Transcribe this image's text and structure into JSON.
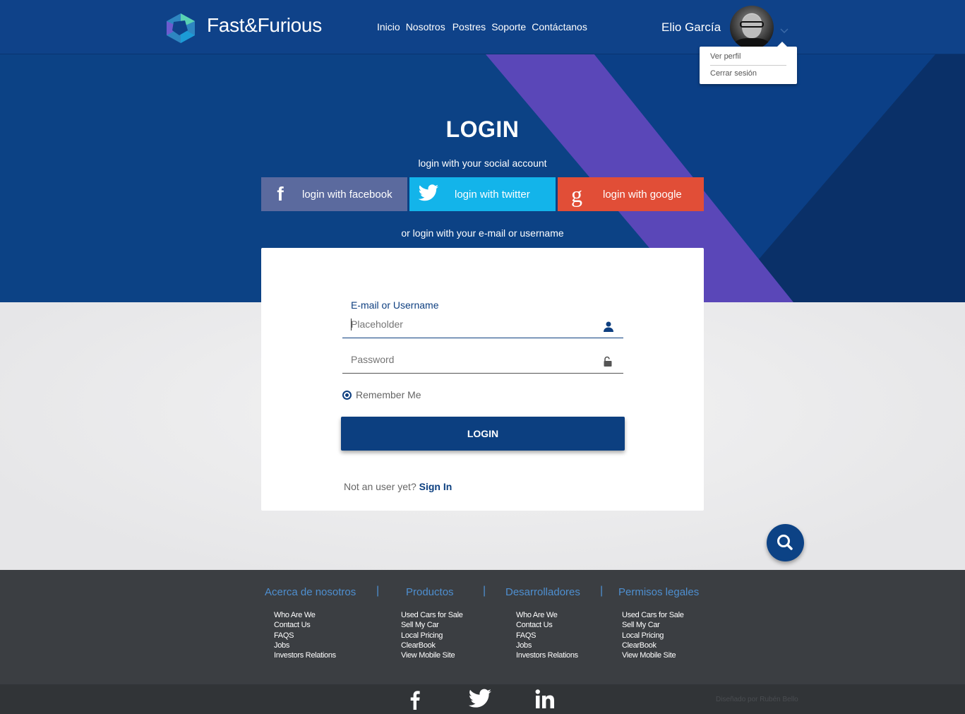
{
  "header": {
    "brand": "Fast&Furious",
    "nav": [
      "Inicio",
      "Nosotros",
      "Postres",
      "Soporte",
      "Contáctanos"
    ],
    "user_name": "Elio García",
    "dropdown": [
      "Ver perfil",
      "Cerrar sesión"
    ]
  },
  "login": {
    "title": "LOGIN",
    "social_caption": "login with your social account",
    "facebook_label": "login with facebook",
    "twitter_label": "login with twitter",
    "google_label": "login with google",
    "or_caption": "or login with your e-mail or username"
  },
  "form": {
    "user_label": "E-mail or Username",
    "user_placeholder": "Placeholder",
    "password_placeholder": "Password",
    "remember_label": "Remember Me",
    "remember_checked": true,
    "submit_label": "LOGIN",
    "not_user_text": "Not an user yet?",
    "sign_in_link": "Sign In"
  },
  "footer": {
    "columns": [
      {
        "heading": "Acerca de nosotros",
        "links": [
          "Who Are We",
          "Contact Us",
          "FAQS",
          "Jobs",
          "Investors Relations"
        ]
      },
      {
        "heading": "Productos",
        "links": [
          "Used Cars for Sale",
          "Sell My Car",
          "Local Pricing",
          "ClearBook",
          "View Mobile Site"
        ]
      },
      {
        "heading": "Desarrolladores",
        "links": [
          "Who Are We",
          "Contact Us",
          "FAQS",
          "Jobs",
          "Investors Relations"
        ]
      },
      {
        "heading": "Permisos legales",
        "links": [
          "Used Cars for Sale",
          "Sell My Car",
          "Local Pricing",
          "ClearBook",
          "View Mobile Site"
        ]
      }
    ],
    "separator": "|",
    "credit": "Diseñado por Rubén Bello"
  },
  "icons": [
    "logo-icon",
    "chevron-down-icon",
    "facebook-icon",
    "twitter-icon",
    "google-icon",
    "user-icon",
    "lock-icon",
    "search-icon",
    "linkedin-icon"
  ],
  "colors": {
    "primary": "#0c4285",
    "accent_purple": "#5a47b8",
    "facebook": "#5b6a9e",
    "twitter": "#13b4ea",
    "google": "#e14e37",
    "footer": "#3b3e42",
    "footer_heading": "#4e8fd0"
  }
}
